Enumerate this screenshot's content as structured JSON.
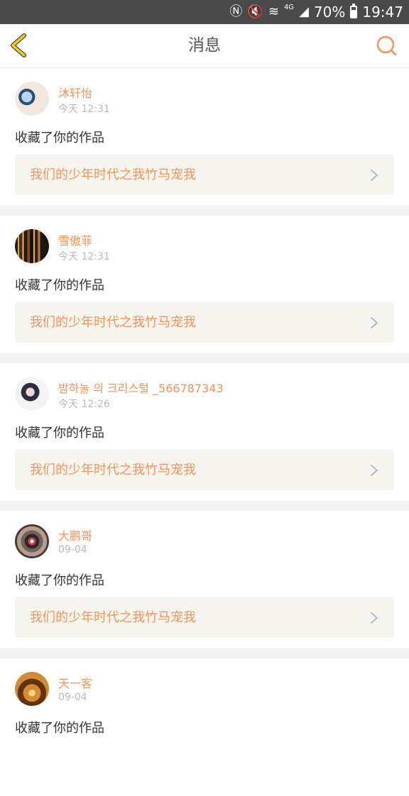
{
  "status_bar": {
    "battery_percent": "70%",
    "time": "19:47",
    "battery_level": 0.7,
    "icons": {
      "nfc": "nfc-icon",
      "mute": "mute-icon",
      "wifi": "wifi-icon",
      "network_label": "4G",
      "signal": "signal-icon",
      "battery": "battery-icon"
    }
  },
  "header": {
    "title": "消息",
    "back_icon": "back-chevron-icon",
    "search_icon": "search-icon"
  },
  "colors": {
    "accent": "#f2935a",
    "muted_text": "#b8b8b8",
    "separator": "#f2f2f2",
    "card_link_bg": "#f5f4ee"
  },
  "messages": [
    {
      "username": "沐轩怡",
      "time": "今天 12:31",
      "action": "收藏了你的作品",
      "work_title": "我们的少年时代之我竹马宠我"
    },
    {
      "username": "雪傲菲",
      "time": "今天 12:31",
      "action": "收藏了你的作品",
      "work_title": "我们的少年时代之我竹马宠我"
    },
    {
      "username": "밤하늘 의 크리스털 _566787343",
      "time": "今天 12:26",
      "action": "收藏了你的作品",
      "work_title": "我们的少年时代之我竹马宠我"
    },
    {
      "username": "大鹏哥",
      "time": "09-04",
      "action": "收藏了你的作品",
      "work_title": "我们的少年时代之我竹马宠我"
    },
    {
      "username": "天一客",
      "time": "09-04",
      "action": "收藏了你的作品",
      "work_title": ""
    }
  ]
}
